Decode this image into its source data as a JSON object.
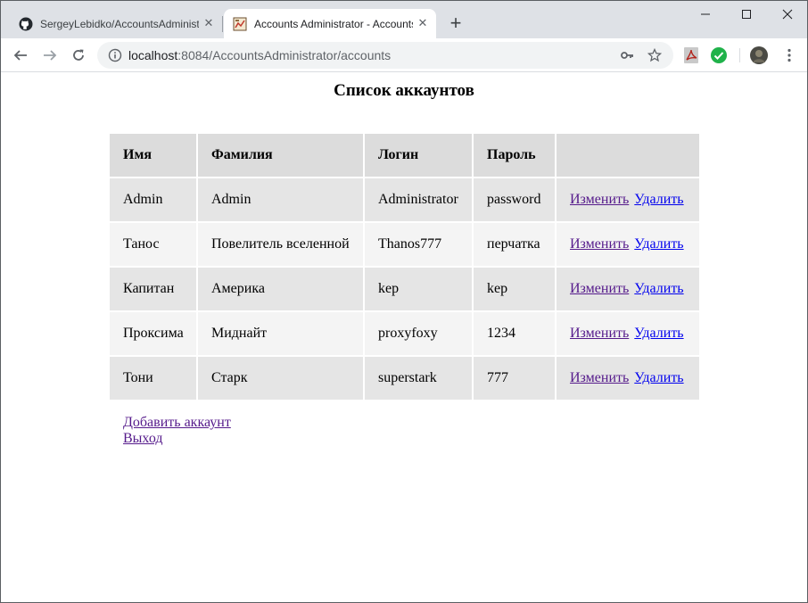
{
  "browser": {
    "tabs": [
      {
        "title": "SergeyLebidko/AccountsAdministrator",
        "active": false,
        "favicon": "github-icon"
      },
      {
        "title": "Accounts Administrator - Accounts",
        "active": true,
        "favicon": "page-icon"
      }
    ],
    "url_host": "localhost",
    "url_rest": ":8084/AccountsAdministrator/accounts"
  },
  "page": {
    "title": "Список аккаунтов",
    "table": {
      "headers": [
        "Имя",
        "Фамилия",
        "Логин",
        "Пароль",
        ""
      ],
      "rows": [
        {
          "first_name": "Admin",
          "last_name": "Admin",
          "login": "Administrator",
          "password": "password"
        },
        {
          "first_name": "Танос",
          "last_name": "Повелитель вселенной",
          "login": "Thanos777",
          "password": "перчатка"
        },
        {
          "first_name": "Капитан",
          "last_name": "Америка",
          "login": "kep",
          "password": "kep"
        },
        {
          "first_name": "Проксима",
          "last_name": "Миднайт",
          "login": "proxyfoxy",
          "password": "1234"
        },
        {
          "first_name": "Тони",
          "last_name": "Старк",
          "login": "superstark",
          "password": "777"
        }
      ],
      "edit_label": "Изменить",
      "delete_label": "Удалить"
    },
    "add_link": "Добавить аккаунт",
    "logout_link": "Выход"
  },
  "colors": {
    "visited_link": "#551a8b",
    "link": "#0000ee",
    "header_bg": "#dcdcdc",
    "row_odd_bg": "#e5e5e5",
    "row_even_bg": "#f4f4f4"
  }
}
